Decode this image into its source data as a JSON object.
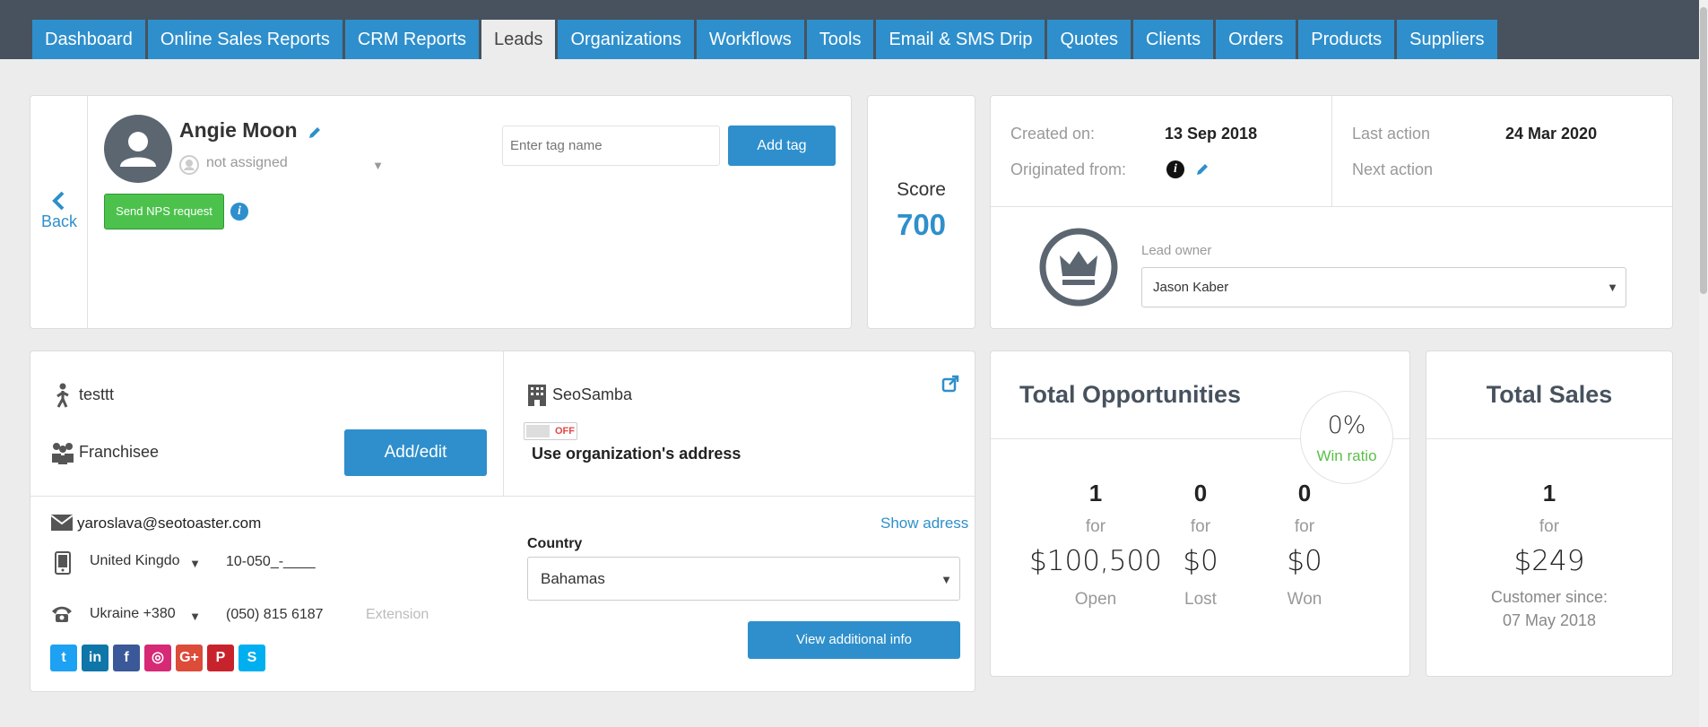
{
  "nav": {
    "tabs": [
      "Dashboard",
      "Online Sales Reports",
      "CRM Reports",
      "Leads",
      "Organizations",
      "Workflows",
      "Tools",
      "Email & SMS Drip",
      "Quotes",
      "Clients",
      "Orders",
      "Products",
      "Suppliers"
    ],
    "active_tab": "Leads"
  },
  "profile": {
    "back_label": "Back",
    "name": "Angie Moon",
    "assignee": "not assigned",
    "nps_button": "Send NPS request",
    "tag_placeholder": "Enter tag name",
    "add_tag_button": "Add tag"
  },
  "score": {
    "label": "Score",
    "value": "700"
  },
  "meta": {
    "created_label": "Created on:",
    "created_value": "13 Sep 2018",
    "originated_label": "Originated from:",
    "last_action_label": "Last action",
    "last_action_value": "24 Mar 2020",
    "next_action_label": "Next action",
    "owner_label": "Lead owner",
    "owner_value": "Jason Kaber"
  },
  "contact": {
    "job": "testtt",
    "role": "Franchisee",
    "add_edit_button": "Add/edit",
    "organization": "SeoSamba",
    "toggle_state": "OFF",
    "use_org_address": "Use organization's address",
    "email": "yaroslava@seotoaster.com",
    "show_address": "Show adress",
    "mobile_country": "United Kingdo",
    "mobile_number": "10-050_-____",
    "phone_country": "Ukraine +380",
    "phone_number": "(050) 815 6187",
    "extension_placeholder": "Extension",
    "country_label": "Country",
    "country_value": "Bahamas",
    "view_info_button": "View additional info",
    "social": [
      "twitter-icon",
      "linkedin-icon",
      "facebook-icon",
      "instagram-icon",
      "google-plus-icon",
      "pinterest-icon",
      "skype-icon"
    ]
  },
  "opportunities": {
    "title": "Total Opportunities",
    "win_ratio_value": "0%",
    "win_ratio_label": "Win ratio",
    "stats": [
      {
        "count": "1",
        "for": "for",
        "amount": "$100,500",
        "caption": "Open"
      },
      {
        "count": "0",
        "for": "for",
        "amount": "$0",
        "caption": "Lost"
      },
      {
        "count": "0",
        "for": "for",
        "amount": "$0",
        "caption": "Won"
      }
    ]
  },
  "sales": {
    "title": "Total Sales",
    "count": "1",
    "for": "for",
    "amount": "$249",
    "customer_since_label": "Customer since:",
    "customer_since_date": "07 May 2018"
  },
  "colors": {
    "accent": "#2e8fcc",
    "topbar": "#47525e",
    "green": "#4cc24c",
    "win": "#5bbf4a"
  }
}
